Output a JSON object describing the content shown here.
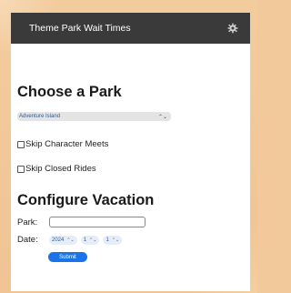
{
  "header": {
    "title": "Theme Park Wait Times",
    "settings_icon": "gear-icon"
  },
  "choose_park": {
    "heading": "Choose a Park",
    "select": {
      "selected": "Adventure Island",
      "chevron": "⌃⌄"
    },
    "options": [
      {
        "label": "Skip Character Meets",
        "checked": false
      },
      {
        "label": "Skip Closed Rides",
        "checked": false
      }
    ]
  },
  "configure_vacation": {
    "heading": "Configure Vacation",
    "park_label": "Park:",
    "park_value": "",
    "date_label": "Date:",
    "date_parts": [
      "2024",
      "1",
      "1"
    ],
    "submit_label": "Submit"
  },
  "colors": {
    "header_bg": "#3a3a3a",
    "accent": "#1a73e8",
    "page_bg": "#f2c99a"
  }
}
